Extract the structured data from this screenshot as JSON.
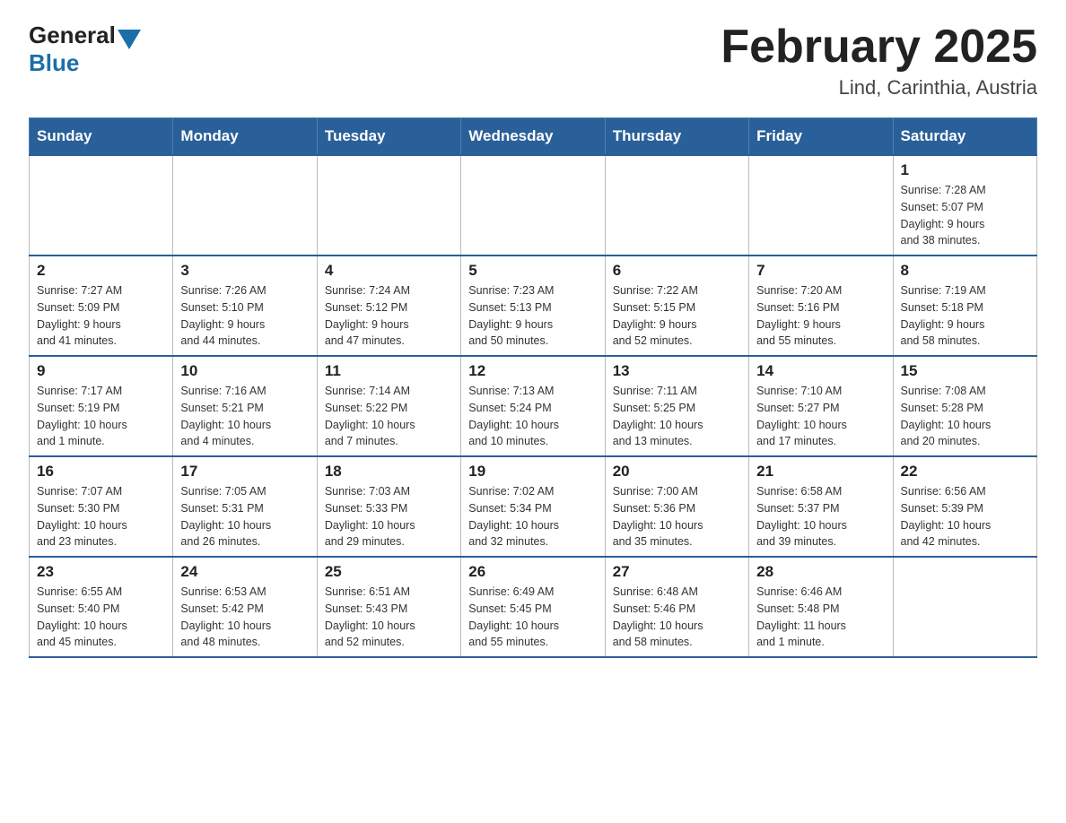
{
  "header": {
    "logo_general": "General",
    "logo_blue": "Blue",
    "title": "February 2025",
    "subtitle": "Lind, Carinthia, Austria"
  },
  "days_of_week": [
    "Sunday",
    "Monday",
    "Tuesday",
    "Wednesday",
    "Thursday",
    "Friday",
    "Saturday"
  ],
  "weeks": [
    [
      {
        "day": "",
        "info": ""
      },
      {
        "day": "",
        "info": ""
      },
      {
        "day": "",
        "info": ""
      },
      {
        "day": "",
        "info": ""
      },
      {
        "day": "",
        "info": ""
      },
      {
        "day": "",
        "info": ""
      },
      {
        "day": "1",
        "info": "Sunrise: 7:28 AM\nSunset: 5:07 PM\nDaylight: 9 hours\nand 38 minutes."
      }
    ],
    [
      {
        "day": "2",
        "info": "Sunrise: 7:27 AM\nSunset: 5:09 PM\nDaylight: 9 hours\nand 41 minutes."
      },
      {
        "day": "3",
        "info": "Sunrise: 7:26 AM\nSunset: 5:10 PM\nDaylight: 9 hours\nand 44 minutes."
      },
      {
        "day": "4",
        "info": "Sunrise: 7:24 AM\nSunset: 5:12 PM\nDaylight: 9 hours\nand 47 minutes."
      },
      {
        "day": "5",
        "info": "Sunrise: 7:23 AM\nSunset: 5:13 PM\nDaylight: 9 hours\nand 50 minutes."
      },
      {
        "day": "6",
        "info": "Sunrise: 7:22 AM\nSunset: 5:15 PM\nDaylight: 9 hours\nand 52 minutes."
      },
      {
        "day": "7",
        "info": "Sunrise: 7:20 AM\nSunset: 5:16 PM\nDaylight: 9 hours\nand 55 minutes."
      },
      {
        "day": "8",
        "info": "Sunrise: 7:19 AM\nSunset: 5:18 PM\nDaylight: 9 hours\nand 58 minutes."
      }
    ],
    [
      {
        "day": "9",
        "info": "Sunrise: 7:17 AM\nSunset: 5:19 PM\nDaylight: 10 hours\nand 1 minute."
      },
      {
        "day": "10",
        "info": "Sunrise: 7:16 AM\nSunset: 5:21 PM\nDaylight: 10 hours\nand 4 minutes."
      },
      {
        "day": "11",
        "info": "Sunrise: 7:14 AM\nSunset: 5:22 PM\nDaylight: 10 hours\nand 7 minutes."
      },
      {
        "day": "12",
        "info": "Sunrise: 7:13 AM\nSunset: 5:24 PM\nDaylight: 10 hours\nand 10 minutes."
      },
      {
        "day": "13",
        "info": "Sunrise: 7:11 AM\nSunset: 5:25 PM\nDaylight: 10 hours\nand 13 minutes."
      },
      {
        "day": "14",
        "info": "Sunrise: 7:10 AM\nSunset: 5:27 PM\nDaylight: 10 hours\nand 17 minutes."
      },
      {
        "day": "15",
        "info": "Sunrise: 7:08 AM\nSunset: 5:28 PM\nDaylight: 10 hours\nand 20 minutes."
      }
    ],
    [
      {
        "day": "16",
        "info": "Sunrise: 7:07 AM\nSunset: 5:30 PM\nDaylight: 10 hours\nand 23 minutes."
      },
      {
        "day": "17",
        "info": "Sunrise: 7:05 AM\nSunset: 5:31 PM\nDaylight: 10 hours\nand 26 minutes."
      },
      {
        "day": "18",
        "info": "Sunrise: 7:03 AM\nSunset: 5:33 PM\nDaylight: 10 hours\nand 29 minutes."
      },
      {
        "day": "19",
        "info": "Sunrise: 7:02 AM\nSunset: 5:34 PM\nDaylight: 10 hours\nand 32 minutes."
      },
      {
        "day": "20",
        "info": "Sunrise: 7:00 AM\nSunset: 5:36 PM\nDaylight: 10 hours\nand 35 minutes."
      },
      {
        "day": "21",
        "info": "Sunrise: 6:58 AM\nSunset: 5:37 PM\nDaylight: 10 hours\nand 39 minutes."
      },
      {
        "day": "22",
        "info": "Sunrise: 6:56 AM\nSunset: 5:39 PM\nDaylight: 10 hours\nand 42 minutes."
      }
    ],
    [
      {
        "day": "23",
        "info": "Sunrise: 6:55 AM\nSunset: 5:40 PM\nDaylight: 10 hours\nand 45 minutes."
      },
      {
        "day": "24",
        "info": "Sunrise: 6:53 AM\nSunset: 5:42 PM\nDaylight: 10 hours\nand 48 minutes."
      },
      {
        "day": "25",
        "info": "Sunrise: 6:51 AM\nSunset: 5:43 PM\nDaylight: 10 hours\nand 52 minutes."
      },
      {
        "day": "26",
        "info": "Sunrise: 6:49 AM\nSunset: 5:45 PM\nDaylight: 10 hours\nand 55 minutes."
      },
      {
        "day": "27",
        "info": "Sunrise: 6:48 AM\nSunset: 5:46 PM\nDaylight: 10 hours\nand 58 minutes."
      },
      {
        "day": "28",
        "info": "Sunrise: 6:46 AM\nSunset: 5:48 PM\nDaylight: 11 hours\nand 1 minute."
      },
      {
        "day": "",
        "info": ""
      }
    ]
  ]
}
